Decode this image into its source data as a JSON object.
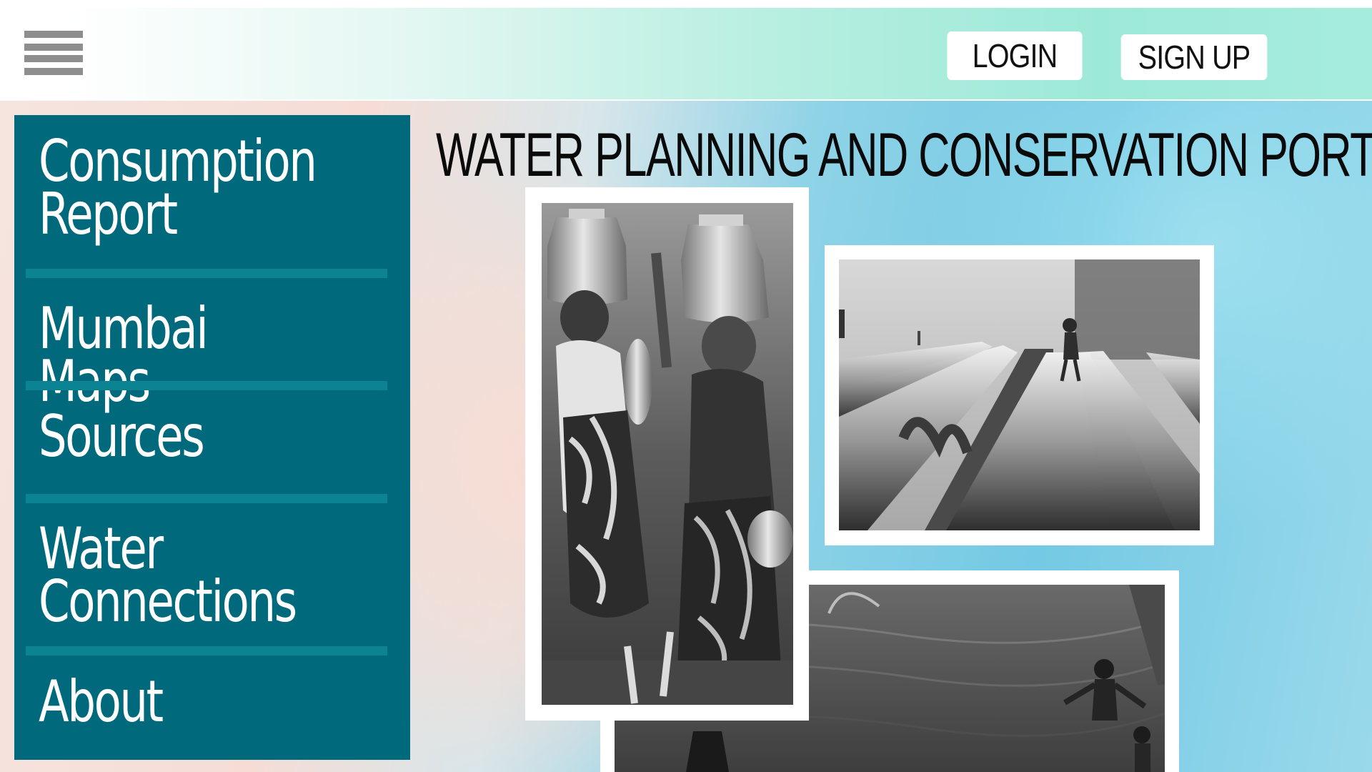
{
  "header": {
    "menu_icon": "hamburger-menu-icon",
    "login_label": "LOGIN",
    "signup_label": "SIGN UP"
  },
  "page": {
    "title": "WATER PLANNING AND CONSERVATION PORTAL"
  },
  "sidebar": {
    "items": [
      {
        "label": "Consumption\nReport"
      },
      {
        "label": "Mumbai Maps"
      },
      {
        "label": "Sources"
      },
      {
        "label": "Water\nConnections"
      },
      {
        "label": "About"
      }
    ]
  },
  "colors": {
    "sidebar_bg": "#006a7c",
    "divider": "#0b8393",
    "header_accent": "#9de9d8"
  },
  "images": [
    {
      "name": "women-carrying-water-pots-photo"
    },
    {
      "name": "child-walking-on-pipelines-photo"
    },
    {
      "name": "children-playing-in-flooded-water-photo"
    }
  ]
}
